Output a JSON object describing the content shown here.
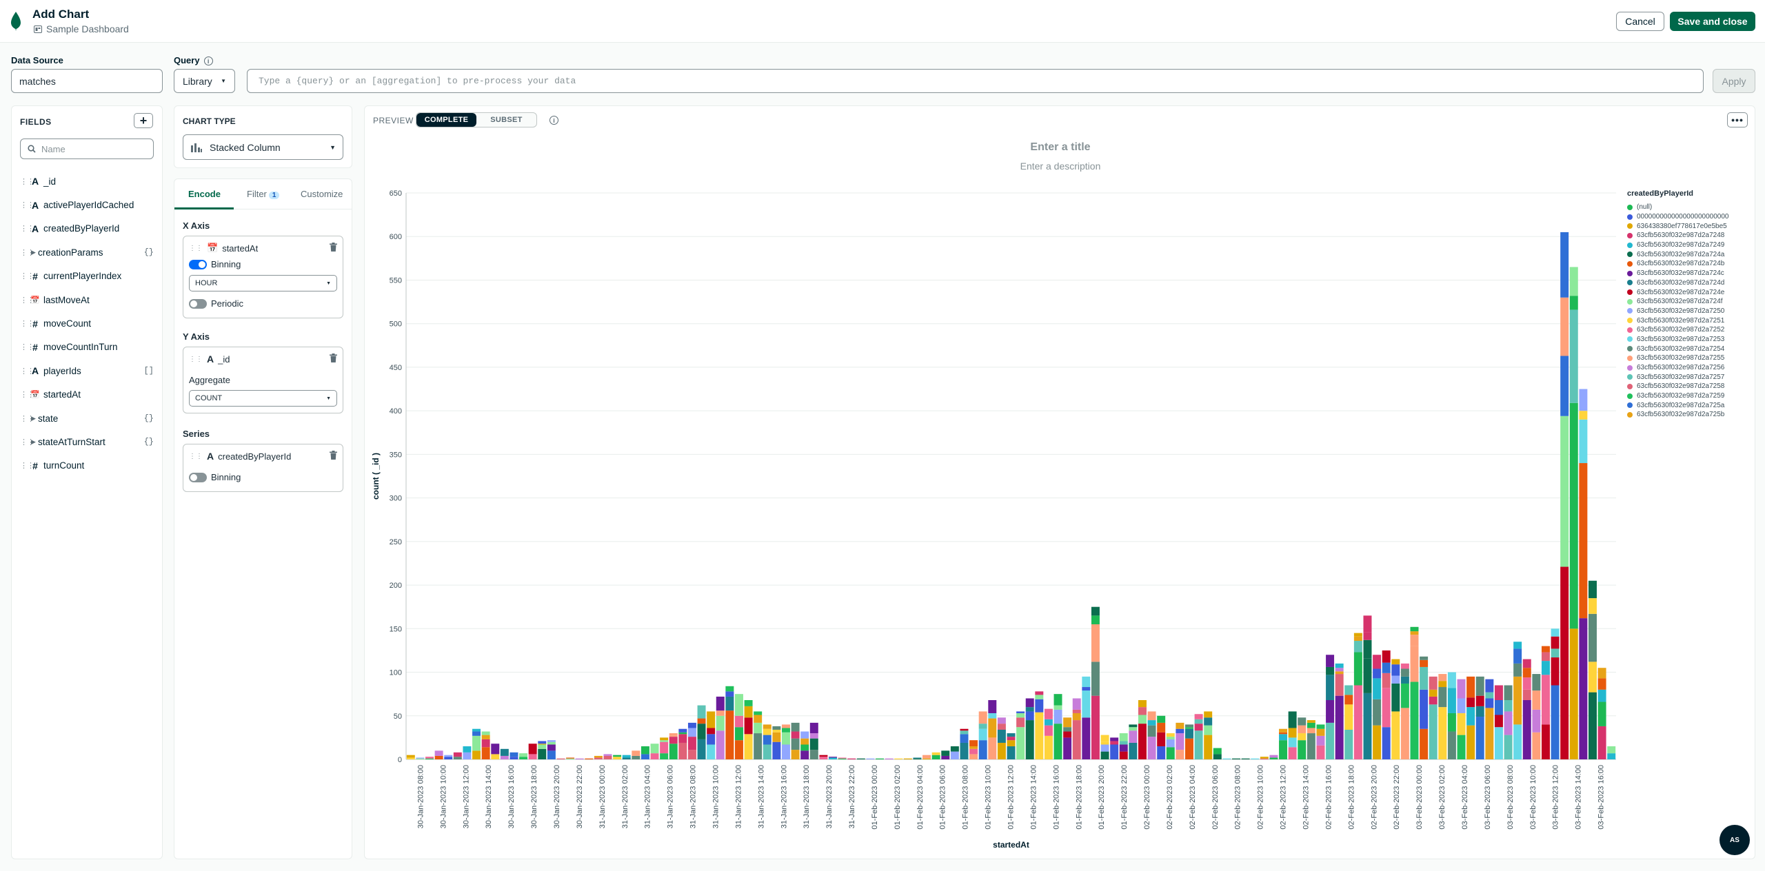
{
  "header": {
    "title": "Add Chart",
    "dashboard": "Sample Dashboard",
    "cancel_label": "Cancel",
    "save_label": "Save and close"
  },
  "data_source": {
    "label": "Data Source",
    "value": "matches"
  },
  "query": {
    "label": "Query",
    "mode": "Library",
    "placeholder": "Type a {query} or an [aggregation] to pre-process your data",
    "apply_label": "Apply"
  },
  "fields": {
    "title": "FIELDS",
    "search_placeholder": "Name",
    "items": [
      {
        "name": "_id",
        "type": "A",
        "expandable": false,
        "suffix": ""
      },
      {
        "name": "activePlayerIdCached",
        "type": "A",
        "expandable": false,
        "suffix": ""
      },
      {
        "name": "createdByPlayerId",
        "type": "A",
        "expandable": false,
        "suffix": ""
      },
      {
        "name": "creationParams",
        "type": "",
        "expandable": true,
        "suffix": "{}"
      },
      {
        "name": "currentPlayerIndex",
        "type": "#",
        "expandable": false,
        "suffix": ""
      },
      {
        "name": "lastMoveAt",
        "type": "date",
        "expandable": false,
        "suffix": ""
      },
      {
        "name": "moveCount",
        "type": "#",
        "expandable": false,
        "suffix": ""
      },
      {
        "name": "moveCountInTurn",
        "type": "#",
        "expandable": false,
        "suffix": ""
      },
      {
        "name": "playerIds",
        "type": "A",
        "expandable": false,
        "suffix": "[]"
      },
      {
        "name": "startedAt",
        "type": "date",
        "expandable": false,
        "suffix": ""
      },
      {
        "name": "state",
        "type": "",
        "expandable": true,
        "suffix": "{}"
      },
      {
        "name": "stateAtTurnStart",
        "type": "",
        "expandable": true,
        "suffix": "{}"
      },
      {
        "name": "turnCount",
        "type": "#",
        "expandable": false,
        "suffix": ""
      }
    ]
  },
  "chart_type": {
    "label": "CHART TYPE",
    "value": "Stacked Column"
  },
  "encode": {
    "tabs": [
      "Encode",
      "Filter",
      "Customize"
    ],
    "filter_count": "1",
    "x_axis": {
      "label": "X Axis",
      "field": "startedAt",
      "binning_label": "Binning",
      "bin_unit": "HOUR",
      "periodic_label": "Periodic",
      "binning_on": true,
      "periodic_on": false
    },
    "y_axis": {
      "label": "Y Axis",
      "field": "_id",
      "aggregate_label": "Aggregate",
      "aggregate": "COUNT"
    },
    "series": {
      "label": "Series",
      "field": "createdByPlayerId",
      "binning_label": "Binning",
      "binning_on": false
    }
  },
  "preview": {
    "label": "PREVIEW",
    "modes": [
      "COMPLETE",
      "SUBSET"
    ],
    "active_mode": "COMPLETE",
    "title_placeholder": "Enter a title",
    "description_placeholder": "Enter a description",
    "more_label": "•••"
  },
  "help_label": "AS",
  "chart_data": {
    "type": "bar",
    "stacked": true,
    "xlabel": "startedAt",
    "ylabel": "count ( _id )",
    "ylim": [
      0,
      650
    ],
    "yticks": [
      0,
      50,
      100,
      150,
      200,
      250,
      300,
      350,
      400,
      450,
      500,
      550,
      600,
      650
    ],
    "grid": true,
    "legend_position": "right",
    "legend_title": "createdByPlayerId",
    "x_tick_labels": [
      "30-Jan-2023 08:00",
      "30-Jan-2023 10:00",
      "30-Jan-2023 12:00",
      "30-Jan-2023 14:00",
      "30-Jan-2023 16:00",
      "30-Jan-2023 18:00",
      "30-Jan-2023 20:00",
      "30-Jan-2023 22:00",
      "31-Jan-2023 00:00",
      "31-Jan-2023 02:00",
      "31-Jan-2023 04:00",
      "31-Jan-2023 06:00",
      "31-Jan-2023 08:00",
      "31-Jan-2023 10:00",
      "31-Jan-2023 12:00",
      "31-Jan-2023 14:00",
      "31-Jan-2023 16:00",
      "31-Jan-2023 18:00",
      "31-Jan-2023 20:00",
      "31-Jan-2023 22:00",
      "01-Feb-2023 00:00",
      "01-Feb-2023 02:00",
      "01-Feb-2023 04:00",
      "01-Feb-2023 06:00",
      "01-Feb-2023 08:00",
      "01-Feb-2023 10:00",
      "01-Feb-2023 12:00",
      "01-Feb-2023 14:00",
      "01-Feb-2023 16:00",
      "01-Feb-2023 18:00",
      "01-Feb-2023 20:00",
      "01-Feb-2023 22:00",
      "02-Feb-2023 00:00",
      "02-Feb-2023 02:00",
      "02-Feb-2023 04:00",
      "02-Feb-2023 06:00",
      "02-Feb-2023 08:00",
      "02-Feb-2023 10:00",
      "02-Feb-2023 12:00",
      "02-Feb-2023 14:00",
      "02-Feb-2023 16:00",
      "02-Feb-2023 18:00",
      "02-Feb-2023 20:00",
      "02-Feb-2023 22:00",
      "03-Feb-2023 00:00",
      "03-Feb-2023 02:00",
      "03-Feb-2023 04:00",
      "03-Feb-2023 06:00",
      "03-Feb-2023 08:00",
      "03-Feb-2023 10:00",
      "03-Feb-2023 12:00",
      "03-Feb-2023 14:00",
      "03-Feb-2023 16:00"
    ],
    "series": [
      {
        "name": "(null)",
        "color": "#1db954"
      },
      {
        "name": "000000000000000000000000",
        "color": "#3b5bdb"
      },
      {
        "name": "636438380ef778617e0e5be5",
        "color": "#e0a800"
      },
      {
        "name": "63cfb5630f032e987d2a7248",
        "color": "#d6336c"
      },
      {
        "name": "63cfb5630f032e987d2a7249",
        "color": "#22b8cf"
      },
      {
        "name": "63cfb5630f032e987d2a724a",
        "color": "#0b6e4f"
      },
      {
        "name": "63cfb5630f032e987d2a724b",
        "color": "#e8590c"
      },
      {
        "name": "63cfb5630f032e987d2a724c",
        "color": "#6a1b9a"
      },
      {
        "name": "63cfb5630f032e987d2a724d",
        "color": "#1a7f8e"
      },
      {
        "name": "63cfb5630f032e987d2a724e",
        "color": "#c2001f"
      },
      {
        "name": "63cfb5630f032e987d2a724f",
        "color": "#8ce99a"
      },
      {
        "name": "63cfb5630f032e987d2a7250",
        "color": "#91a7ff"
      },
      {
        "name": "63cfb5630f032e987d2a7251",
        "color": "#ffd43b"
      },
      {
        "name": "63cfb5630f032e987d2a7252",
        "color": "#f06595"
      },
      {
        "name": "63cfb5630f032e987d2a7253",
        "color": "#66d9e8"
      },
      {
        "name": "63cfb5630f032e987d2a7254",
        "color": "#5c8a7a"
      },
      {
        "name": "63cfb5630f032e987d2a7255",
        "color": "#ffa07a"
      },
      {
        "name": "63cfb5630f032e987d2a7256",
        "color": "#c77dda"
      },
      {
        "name": "63cfb5630f032e987d2a7257",
        "color": "#5ec4b6"
      },
      {
        "name": "63cfb5630f032e987d2a7258",
        "color": "#e06277"
      },
      {
        "name": "63cfb5630f032e987d2a7259",
        "color": "#20c05c"
      },
      {
        "name": "63cfb5630f032e987d2a725a",
        "color": "#2f6fd6"
      },
      {
        "name": "63cfb5630f032e987d2a725b",
        "color": "#e8a317"
      }
    ],
    "totals": [
      5,
      2,
      3,
      10,
      5,
      8,
      15,
      35,
      32,
      18,
      12,
      8,
      7,
      18,
      21,
      22,
      1,
      2,
      1,
      1,
      4,
      6,
      5,
      5,
      10,
      15,
      18,
      25,
      30,
      35,
      42,
      62,
      55,
      72,
      84,
      75,
      68,
      55,
      40,
      38,
      40,
      42,
      32,
      42,
      5,
      3,
      2,
      1,
      1,
      1,
      1,
      1,
      1,
      1,
      2,
      5,
      8,
      10,
      15,
      35,
      22,
      55,
      68,
      48,
      30,
      55,
      70,
      78,
      58,
      75,
      48,
      70,
      95,
      175,
      28,
      25,
      30,
      40,
      68,
      55,
      50,
      30,
      42,
      40,
      52,
      55,
      13,
      1,
      1,
      1,
      1,
      3,
      5,
      35,
      55,
      48,
      45,
      40,
      120,
      110,
      85,
      145,
      165,
      120,
      125,
      115,
      110,
      152,
      118,
      95,
      98,
      100,
      92,
      95,
      95,
      92,
      85,
      85,
      135,
      115,
      98,
      130,
      150,
      605,
      565,
      425,
      205,
      105,
      15
    ],
    "stack_order_note": "values are approximate totals per hourly bin read from the y axis"
  }
}
